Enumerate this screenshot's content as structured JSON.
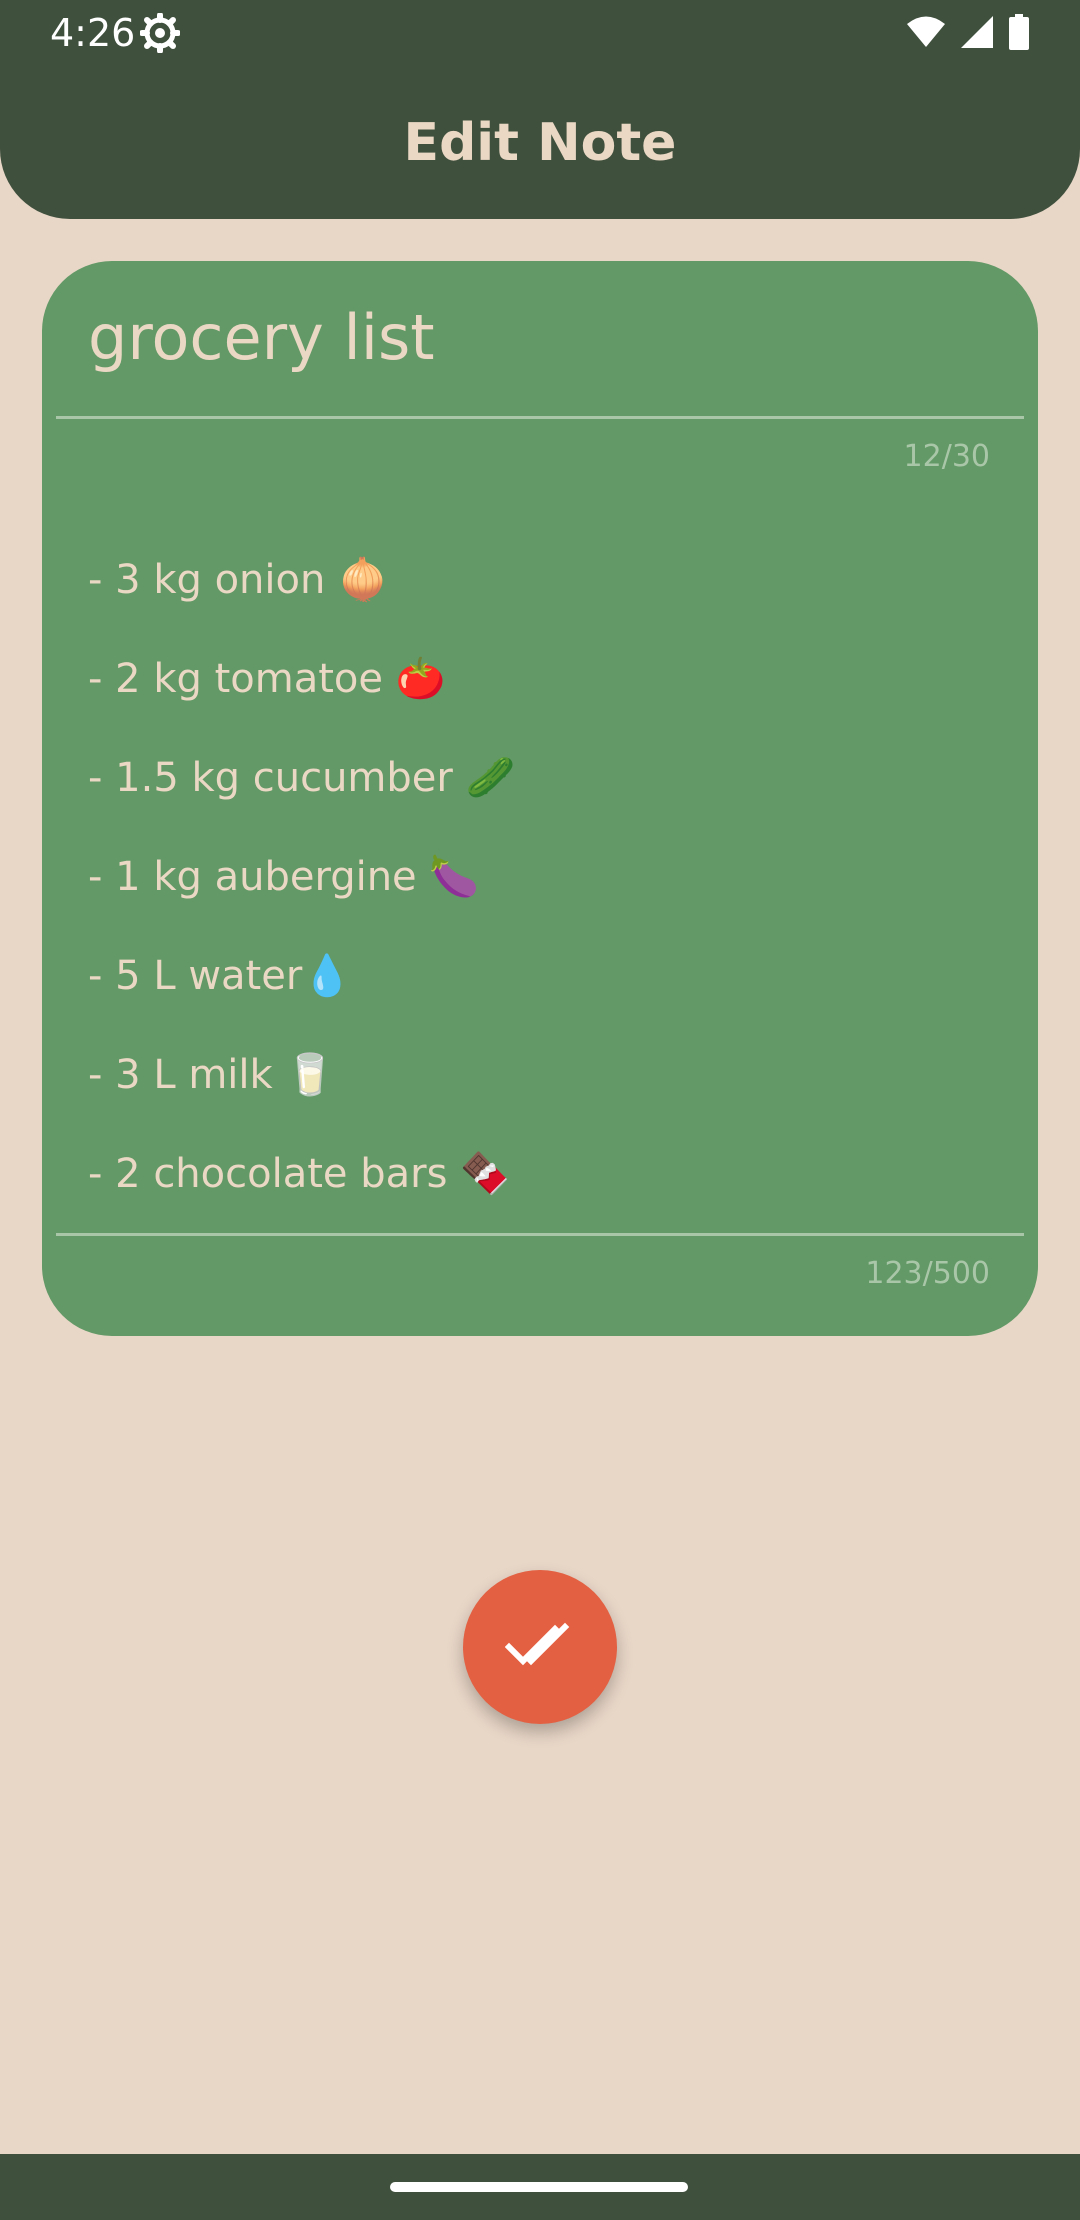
{
  "status_bar": {
    "time": "4:26",
    "icons": [
      "settings-gear-icon",
      "wifi-icon",
      "cellular-signal-icon",
      "battery-icon"
    ]
  },
  "app_bar": {
    "title": "Edit Note"
  },
  "note": {
    "title": "grocery list",
    "title_counter": "12/30",
    "body_lines": [
      "- 3 kg onion 🧅",
      "- 2 kg tomatoe 🍅",
      "- 1.5 kg cucumber 🥒",
      "- 1 kg aubergine 🍆",
      "- 5 L water💧",
      "- 3 L milk 🥛",
      "- 2 chocolate bars 🍫"
    ],
    "body_counter": "123/500"
  },
  "fab": {
    "icon": "double-check-icon"
  },
  "colors": {
    "app_bar": "#3f503d",
    "background": "#e8d6c7",
    "card": "#629966",
    "text_light": "#ead7c4",
    "counter": "#a9c7a8",
    "fab": "#e36042"
  }
}
